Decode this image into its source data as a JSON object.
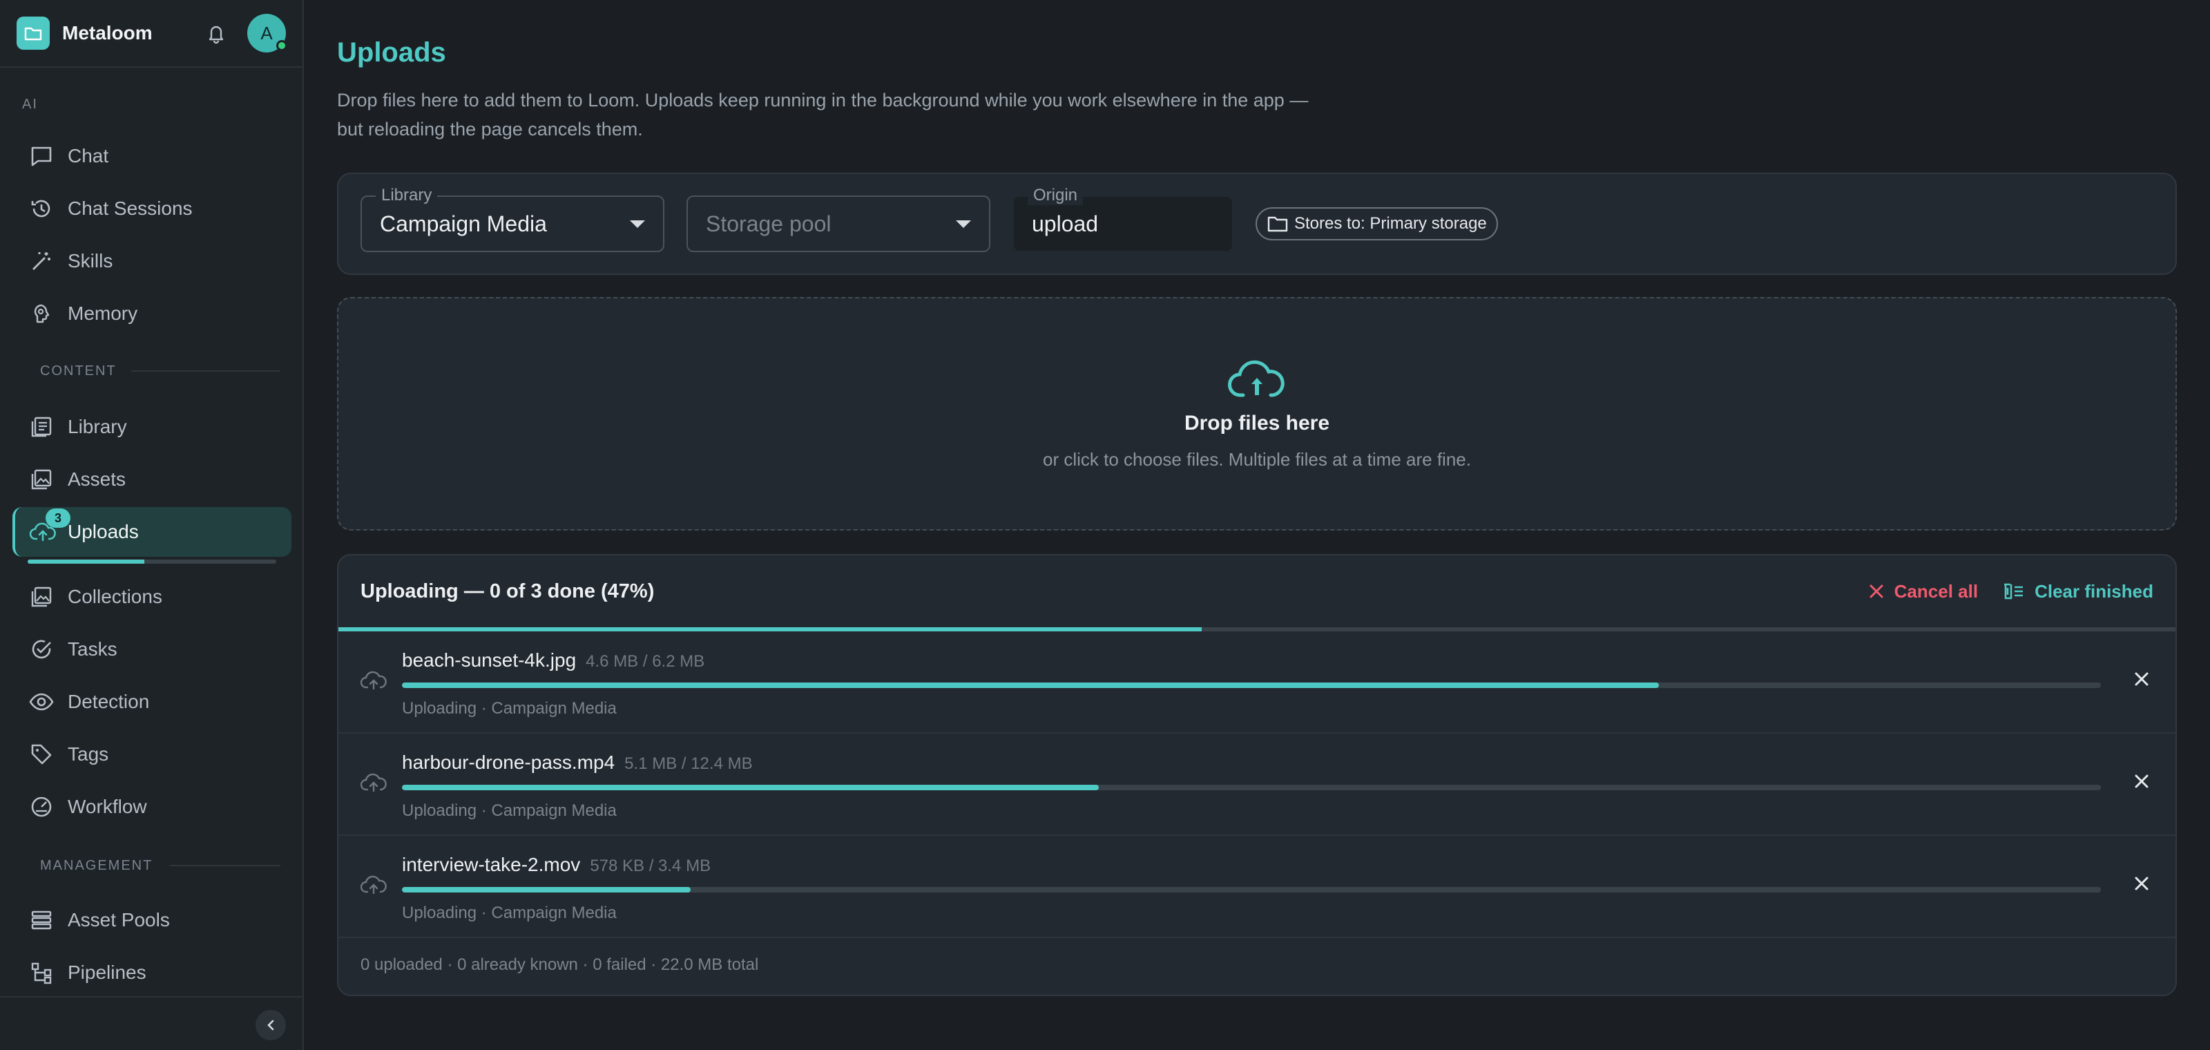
{
  "app": {
    "brand": "Metaloom",
    "avatar_initial": "A"
  },
  "sidebar": {
    "section_ai": "AI",
    "section_content": "CONTENT",
    "section_management": "MANAGEMENT",
    "ai_items": [
      {
        "label": "Chat",
        "icon": "chat-icon"
      },
      {
        "label": "Chat Sessions",
        "icon": "history-icon"
      },
      {
        "label": "Skills",
        "icon": "magic-wand-icon"
      },
      {
        "label": "Memory",
        "icon": "brain-icon"
      }
    ],
    "content_items": [
      {
        "label": "Library",
        "icon": "library-icon"
      },
      {
        "label": "Assets",
        "icon": "image-stack-icon"
      },
      {
        "label": "Uploads",
        "icon": "cloud-upload-icon",
        "active": true,
        "badge": "3",
        "progress": 0.47
      },
      {
        "label": "Collections",
        "icon": "collection-icon"
      },
      {
        "label": "Tasks",
        "icon": "check-circle-icon"
      },
      {
        "label": "Detection",
        "icon": "eye-icon"
      },
      {
        "label": "Tags",
        "icon": "tag-icon"
      },
      {
        "label": "Workflow",
        "icon": "gauge-icon"
      }
    ],
    "management_items": [
      {
        "label": "Asset Pools",
        "icon": "stack-icon"
      },
      {
        "label": "Pipelines",
        "icon": "pipeline-icon"
      }
    ]
  },
  "page": {
    "title": "Uploads",
    "description": "Drop files here to add them to Loom. Uploads keep running in the background while you work elsewhere in the app — but reloading the page cancels them."
  },
  "filters": {
    "library": {
      "label": "Library",
      "value": "Campaign Media"
    },
    "storage_pool": {
      "placeholder": "Storage pool"
    },
    "origin": {
      "label": "Origin",
      "value": "upload"
    },
    "stores_chip": "Stores to: Primary storage"
  },
  "dropzone": {
    "title": "Drop files here",
    "subtitle": "or click to choose files. Multiple files at a time are fine."
  },
  "queue": {
    "title": "Uploading — 0 of 3 done (47%)",
    "progress": 0.47,
    "cancel_all": "Cancel all",
    "clear_finished": "Clear finished",
    "items": [
      {
        "name": "beach-sunset-4k.jpg",
        "size": "4.6 MB / 6.2 MB",
        "progress": 0.74,
        "status": "Uploading · Campaign Media"
      },
      {
        "name": "harbour-drone-pass.mp4",
        "size": "5.1 MB / 12.4 MB",
        "progress": 0.41,
        "status": "Uploading · Campaign Media"
      },
      {
        "name": "interview-take-2.mov",
        "size": "578 KB / 3.4 MB",
        "progress": 0.17,
        "status": "Uploading · Campaign Media"
      }
    ],
    "summary": "0 uploaded · 0 already known · 0 failed · 22.0 MB total"
  },
  "colors": {
    "accent": "#4fc9c3",
    "danger": "#f05a6e",
    "background": "#1b1f24"
  }
}
